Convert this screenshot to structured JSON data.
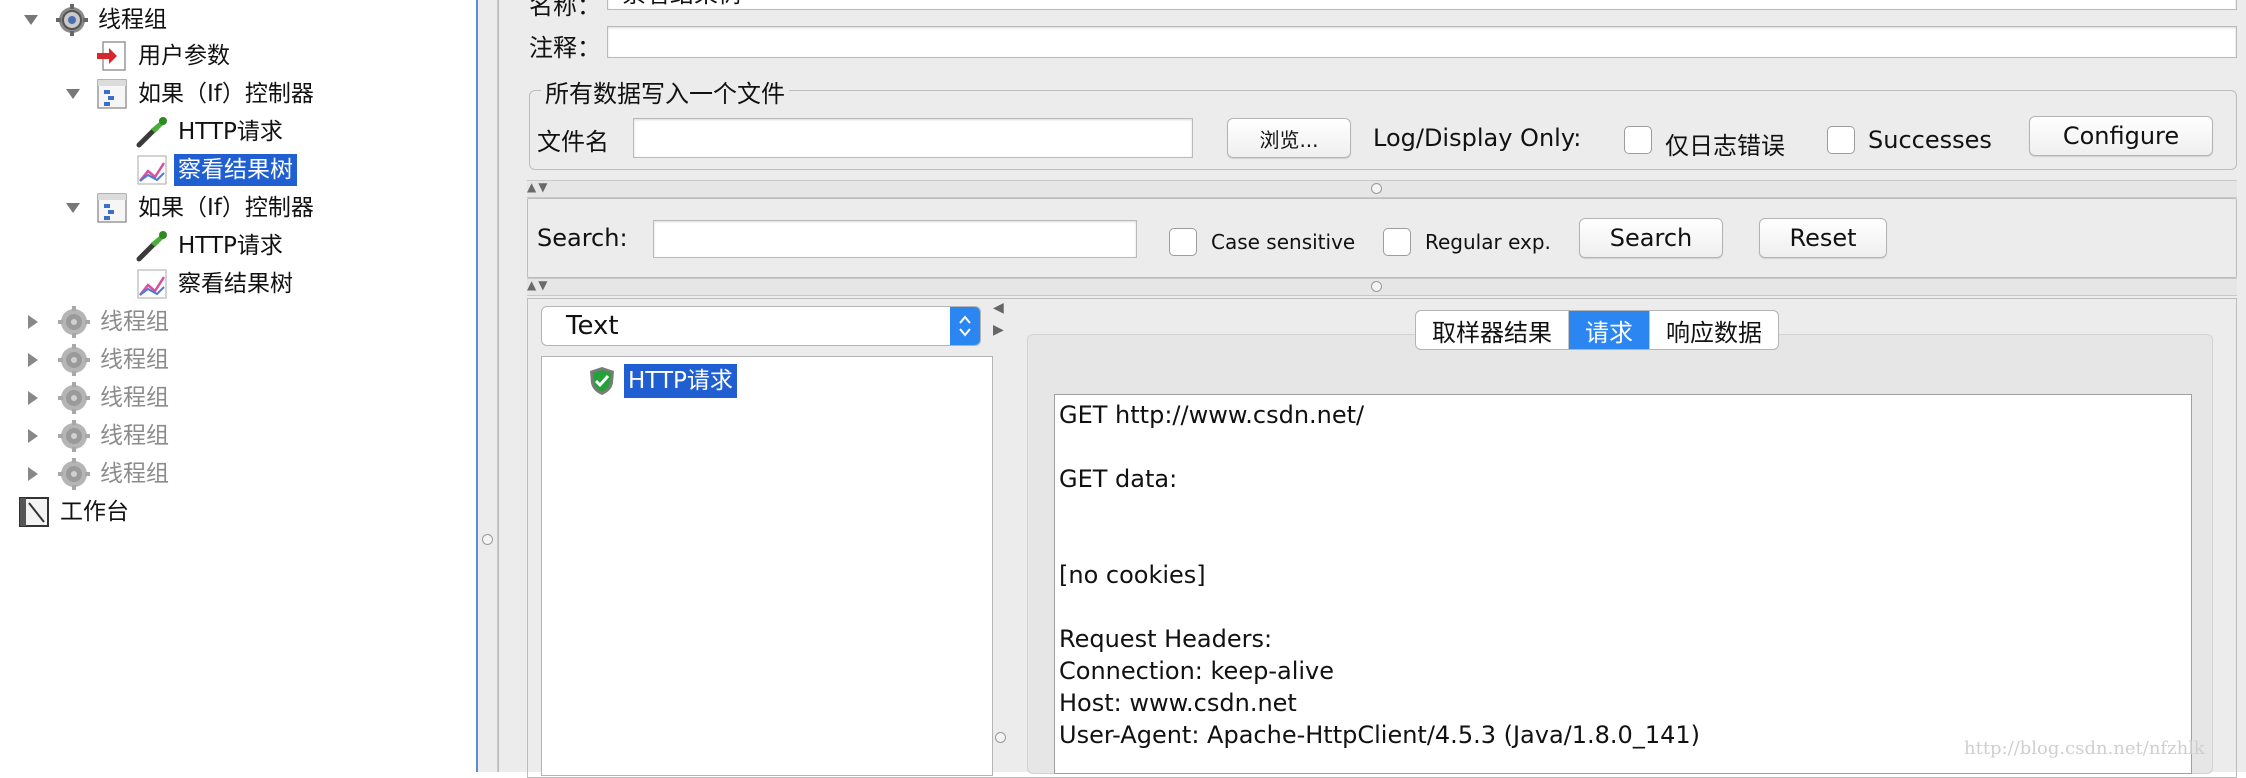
{
  "tree": {
    "nodes": [
      {
        "label": "线程组",
        "level": 1,
        "expanded": true,
        "icon": "gear-icon"
      },
      {
        "label": "用户参数",
        "level": 2,
        "icon": "preprocessor-icon"
      },
      {
        "label": "如果（If）控制器",
        "level": 2,
        "expanded": true,
        "icon": "controller-icon"
      },
      {
        "label": "HTTP请求",
        "level": 3,
        "icon": "pipette-icon"
      },
      {
        "label": "察看结果树",
        "level": 3,
        "selected": true,
        "icon": "graph-icon"
      },
      {
        "label": "如果（If）控制器",
        "level": 2,
        "expanded": true,
        "icon": "controller-icon"
      },
      {
        "label": "HTTP请求",
        "level": 3,
        "icon": "pipette-icon"
      },
      {
        "label": "察看结果树",
        "level": 3,
        "icon": "graph-icon"
      },
      {
        "label": "线程组",
        "level": 1,
        "disabled": true,
        "icon": "gear-icon"
      },
      {
        "label": "线程组",
        "level": 1,
        "disabled": true,
        "icon": "gear-icon"
      },
      {
        "label": "线程组",
        "level": 1,
        "disabled": true,
        "icon": "gear-icon"
      },
      {
        "label": "线程组",
        "level": 1,
        "disabled": true,
        "icon": "gear-icon"
      },
      {
        "label": "线程组",
        "level": 1,
        "disabled": true,
        "icon": "gear-icon"
      },
      {
        "label": "工作台",
        "level": 0,
        "icon": "workbench-icon"
      }
    ]
  },
  "form": {
    "name_label": "名称：",
    "name_value": "察看结果树",
    "comment_label": "注释：",
    "comment_value": ""
  },
  "file_section": {
    "title": "所有数据写入一个文件",
    "filename_label": "文件名",
    "filename_value": "",
    "browse_label": "浏览...",
    "log_display_label": "Log/Display Only:",
    "errors_only_label": "仅日志错误",
    "successes_label": "Successes",
    "configure_label": "Configure"
  },
  "search_bar": {
    "label": "Search:",
    "value": "",
    "case_sensitive_label": "Case sensitive",
    "regex_label": "Regular exp.",
    "search_button": "Search",
    "reset_button": "Reset"
  },
  "results": {
    "renderer": "Text",
    "sample_label": "HTTP请求",
    "tabs": [
      {
        "label": "取样器结果",
        "active": false
      },
      {
        "label": "请求",
        "active": true
      },
      {
        "label": "响应数据",
        "active": false
      }
    ],
    "request_lines": [
      "GET http://www.csdn.net/",
      "",
      "GET data:",
      "",
      "",
      "[no cookies]",
      "",
      "Request Headers:",
      "Connection: keep-alive",
      "Host: www.csdn.net",
      "User-Agent: Apache-HttpClient/4.5.3 (Java/1.8.0_141)"
    ]
  },
  "watermark": "http://blog.csdn.net/nfzhlk",
  "colors": {
    "selection": "#1f5fd1",
    "active_tab": "#2b86f2",
    "panel_bg": "#ececec"
  }
}
